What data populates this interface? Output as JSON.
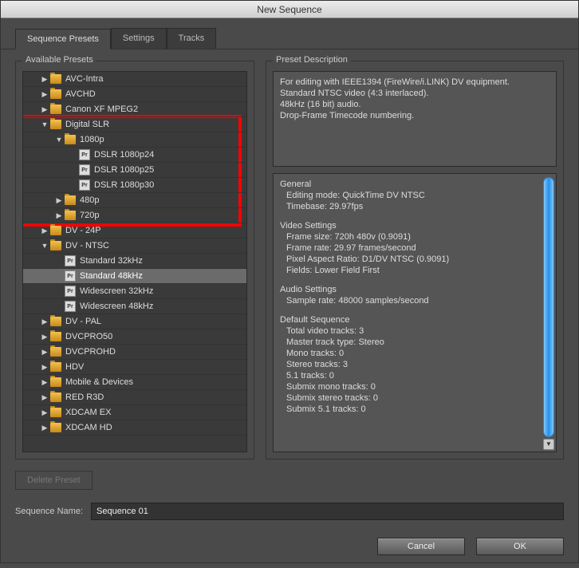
{
  "title": "New Sequence",
  "tabs": {
    "presets": "Sequence Presets",
    "settings": "Settings",
    "tracks": "Tracks"
  },
  "left_label": "Available Presets",
  "right_label": "Preset Description",
  "tree": {
    "avcintra": "AVC-Intra",
    "avchd": "AVCHD",
    "canonxf": "Canon XF MPEG2",
    "dslr": "Digital SLR",
    "p1080": "1080p",
    "dslr24": "DSLR 1080p24",
    "dslr25": "DSLR 1080p25",
    "dslr30": "DSLR 1080p30",
    "p480": "480p",
    "p720": "720p",
    "dv24p": "DV - 24P",
    "dvntsc": "DV - NTSC",
    "std32": "Standard 32kHz",
    "std48": "Standard 48kHz",
    "wide32": "Widescreen 32kHz",
    "wide48": "Widescreen 48kHz",
    "dvpal": "DV - PAL",
    "dvcpro50": "DVCPRO50",
    "dvcprohd": "DVCPROHD",
    "hdv": "HDV",
    "mobile": "Mobile & Devices",
    "red": "RED R3D",
    "xdcamex": "XDCAM EX",
    "xdcamhd": "XDCAM HD"
  },
  "desc": {
    "l1": "For editing with IEEE1394 (FireWire/i.LINK) DV equipment.",
    "l2": "Standard NTSC video (4:3 interlaced).",
    "l3": "48kHz (16 bit) audio.",
    "l4": "Drop-Frame Timecode numbering."
  },
  "details": {
    "general": "General",
    "mode": "Editing mode: QuickTime DV NTSC",
    "timebase": "Timebase: 29.97fps",
    "vs": "Video Settings",
    "fsize": "Frame size: 720h 480v (0.9091)",
    "frate": "Frame rate: 29.97 frames/second",
    "par": "Pixel Aspect Ratio: D1/DV NTSC (0.9091)",
    "fields": "Fields: Lower Field First",
    "as": "Audio Settings",
    "srate": "Sample rate: 48000 samples/second",
    "ds": "Default Sequence",
    "tvt": "Total video tracks: 3",
    "mtt": "Master track type: Stereo",
    "mono": "Mono tracks: 0",
    "stereo": "Stereo tracks: 3",
    "five1": "5.1 tracks: 0",
    "smono": "Submix mono tracks: 0",
    "sstereo": "Submix stereo tracks: 0",
    "s51": "Submix 5.1 tracks: 0"
  },
  "delete": "Delete Preset",
  "seqname_label": "Sequence Name:",
  "seqname_value": "Sequence 01",
  "cancel": "Cancel",
  "ok": "OK"
}
